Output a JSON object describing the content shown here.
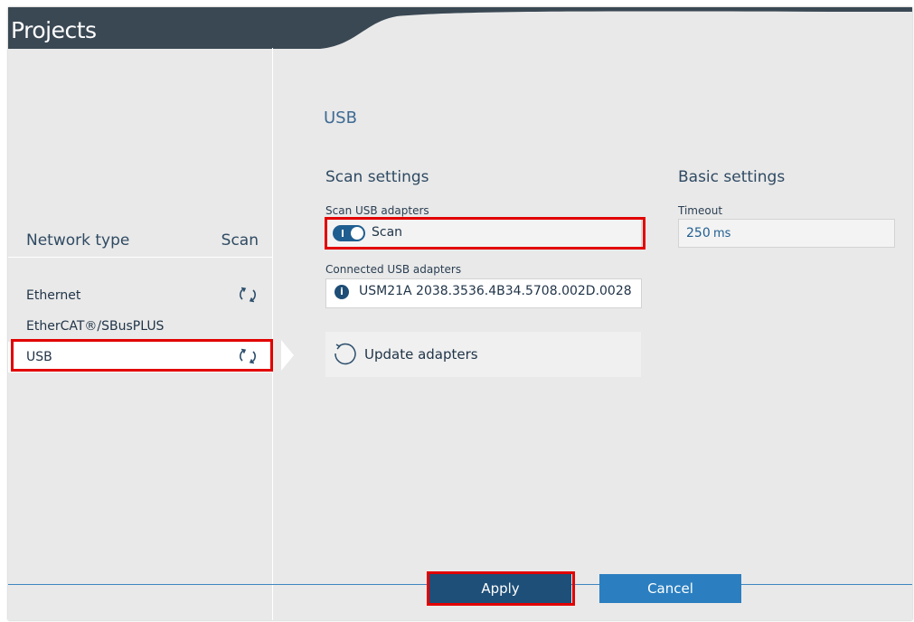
{
  "window": {
    "title": "Projects"
  },
  "sidebar": {
    "header": {
      "network_type": "Network type",
      "scan": "Scan"
    },
    "items": [
      {
        "label": "Ethernet",
        "scan_icon": "refresh-icon",
        "selected": false
      },
      {
        "label": "EtherCAT®/SBusPLUS",
        "selected": false
      },
      {
        "label": "USB",
        "scan_icon": "refresh-icon",
        "selected": true
      }
    ]
  },
  "main": {
    "title": "USB",
    "scan_settings": {
      "title": "Scan settings",
      "scan_usb_label": "Scan USB adapters",
      "toggle_label": "Scan",
      "toggle_on": true,
      "connected_label": "Connected USB adapters",
      "adapter": "USM21A 2038.3536.4B34.5708.002D.0028",
      "update_button": "Update adapters"
    },
    "basic_settings": {
      "title": "Basic settings",
      "timeout_label": "Timeout",
      "timeout_value": "250",
      "timeout_unit": "ms"
    }
  },
  "footer": {
    "apply": "Apply",
    "cancel": "Cancel"
  },
  "colors": {
    "header_bg": "#3a4854",
    "accent": "#1f5e90",
    "apply_bg": "#1e4f78",
    "cancel_bg": "#2b7fc0",
    "highlight": "#e20000"
  }
}
